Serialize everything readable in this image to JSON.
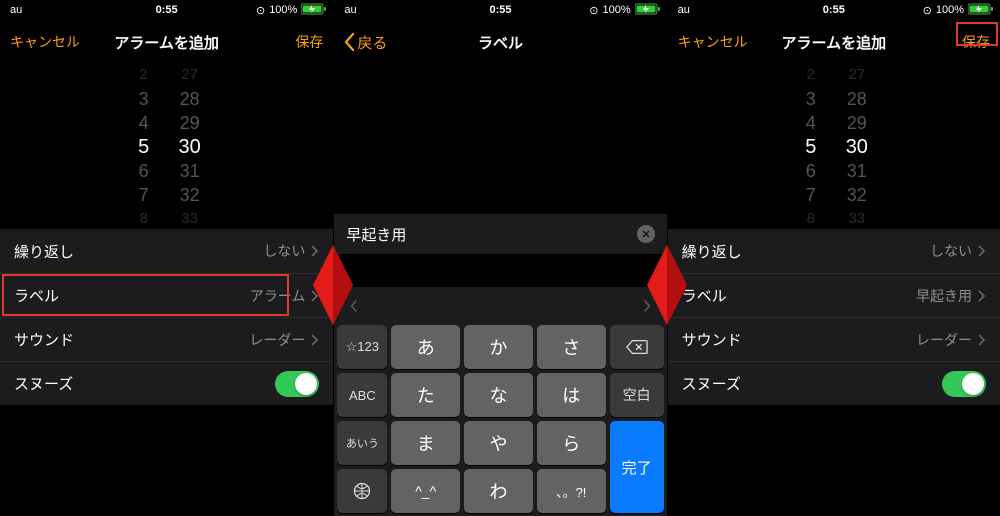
{
  "status": {
    "carrier": "au",
    "time": "0:55",
    "battery_pct": "100%",
    "charging_icon": "🔋"
  },
  "screen1": {
    "nav": {
      "cancel": "キャンセル",
      "title": "アラームを追加",
      "save": "保存"
    },
    "picker": {
      "hours": [
        "2",
        "3",
        "4",
        "5",
        "6",
        "7",
        "8"
      ],
      "mins": [
        "27",
        "28",
        "29",
        "30",
        "31",
        "32",
        "33"
      ],
      "sel_hour": "5",
      "sel_min": "30"
    },
    "rows": {
      "repeat": {
        "label": "繰り返し",
        "value": "しない"
      },
      "labelrow": {
        "label": "ラベル",
        "value": "アラーム"
      },
      "sound": {
        "label": "サウンド",
        "value": "レーダー"
      },
      "snooze": {
        "label": "スヌーズ"
      }
    }
  },
  "screen2": {
    "nav": {
      "back": "戻る",
      "title": "ラベル"
    },
    "field_value": "早起き用",
    "keyboard": {
      "row1": {
        "side": "☆123",
        "k1": "あ",
        "k2": "か",
        "k3": "さ"
      },
      "row2": {
        "side": "ABC",
        "k1": "た",
        "k2": "な",
        "k3": "は",
        "right": "空白"
      },
      "row3": {
        "side": "あいう",
        "k1": "ま",
        "k2": "や",
        "k3": "ら"
      },
      "row4": {
        "k1": "^_^",
        "k2": "わ",
        "k3": "、。?!",
        "done": "完了"
      }
    }
  },
  "screen3": {
    "nav": {
      "cancel": "キャンセル",
      "title": "アラームを追加",
      "save": "保存"
    },
    "rows": {
      "repeat": {
        "label": "繰り返し",
        "value": "しない"
      },
      "labelrow": {
        "label": "ラベル",
        "value": "早起き用"
      },
      "sound": {
        "label": "サウンド",
        "value": "レーダー"
      },
      "snooze": {
        "label": "スヌーズ"
      }
    }
  }
}
